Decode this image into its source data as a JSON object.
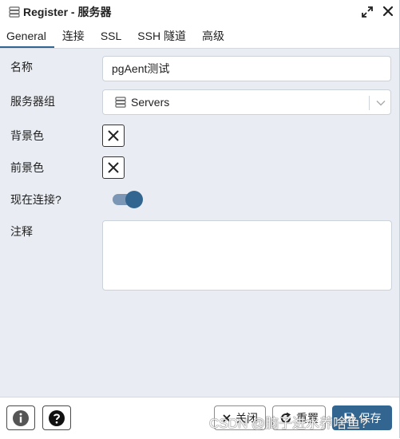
{
  "title": "Register - 服务器",
  "tabs": [
    {
      "label": "General"
    },
    {
      "label": "连接"
    },
    {
      "label": "SSL"
    },
    {
      "label": "SSH 隧道"
    },
    {
      "label": "高级"
    }
  ],
  "form": {
    "name_label": "名称",
    "name_value": "pgAent测试",
    "group_label": "服务器组",
    "group_value": "Servers",
    "bg_label": "背景色",
    "fg_label": "前景色",
    "connect_label": "现在连接?",
    "connect_now": true,
    "comment_label": "注释",
    "comment_value": ""
  },
  "footer": {
    "close_label": "关闭",
    "reset_label": "重置",
    "save_label": "保存"
  },
  "watermark": "CSDN @脑子进水养啥鱼?",
  "colors": {
    "accent": "#326690",
    "background": "#e9edf3"
  },
  "icons": {
    "title": "server-icon",
    "expand": "expand-icon",
    "close": "close-icon",
    "info": "info-icon",
    "help": "help-icon"
  }
}
